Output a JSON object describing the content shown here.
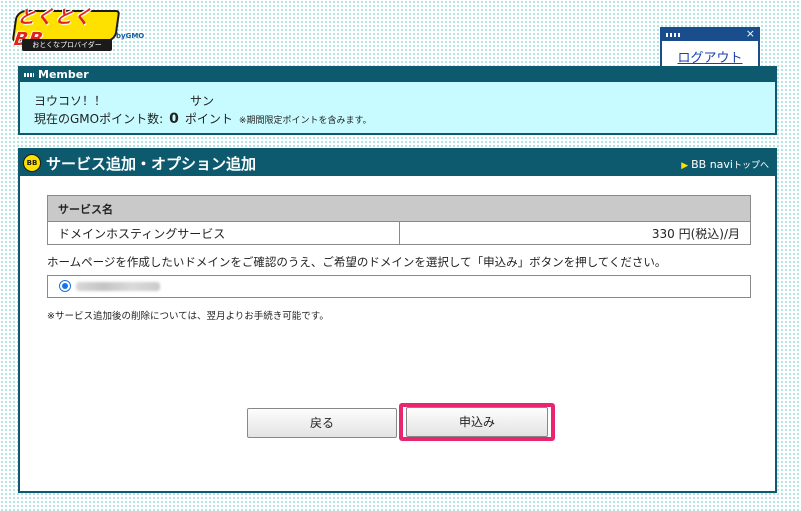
{
  "logo": {
    "brand": "とくとくBB",
    "tagline": "おとくなプロバイダー",
    "company": "byGMO"
  },
  "logout": {
    "label": "ログアウト",
    "close": "×"
  },
  "member": {
    "header": "Member",
    "greeting": "ヨウコソ！！",
    "name": "サン",
    "points_label": "現在のGMOポイント数:",
    "points_value": "0",
    "points_unit": "ポイント",
    "points_note": "※期間限定ポイントを含みます。"
  },
  "main": {
    "badge": "BB",
    "title": "サービス追加・オプション追加",
    "nav_link": "BB navi",
    "nav_link_suffix": "トップへ"
  },
  "table": {
    "header": "サービス名",
    "rows": [
      {
        "name": "ドメインホスティングサービス",
        "price": "330 円(税込)/月"
      }
    ]
  },
  "instruction": "ホームページを作成したいドメインをご確認のうえ、ご希望のドメインを選択して「申込み」ボタンを押してください。",
  "note": "※サービス追加後の削除については、翌月よりお手続き可能です。",
  "buttons": {
    "back": "戻る",
    "apply": "申込み"
  },
  "colors": {
    "header_bg": "#0d5a6e",
    "member_bg": "#c8fbff",
    "highlight": "#e8266f",
    "logo_yellow": "#ffe100",
    "logo_red": "#e0241b"
  }
}
